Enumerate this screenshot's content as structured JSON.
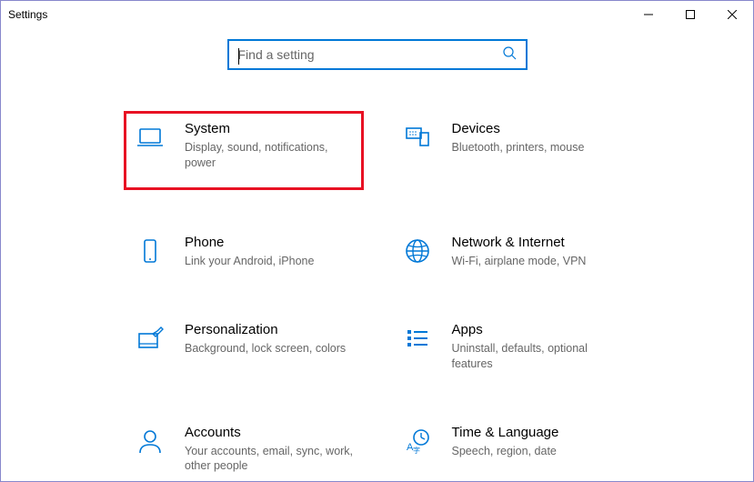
{
  "window": {
    "title": "Settings"
  },
  "search": {
    "placeholder": "Find a setting"
  },
  "categories": [
    {
      "id": "system",
      "title": "System",
      "desc": "Display, sound, notifications, power",
      "highlighted": true
    },
    {
      "id": "devices",
      "title": "Devices",
      "desc": "Bluetooth, printers, mouse",
      "highlighted": false
    },
    {
      "id": "phone",
      "title": "Phone",
      "desc": "Link your Android, iPhone",
      "highlighted": false
    },
    {
      "id": "network",
      "title": "Network & Internet",
      "desc": "Wi-Fi, airplane mode, VPN",
      "highlighted": false
    },
    {
      "id": "personalization",
      "title": "Personalization",
      "desc": "Background, lock screen, colors",
      "highlighted": false
    },
    {
      "id": "apps",
      "title": "Apps",
      "desc": "Uninstall, defaults, optional features",
      "highlighted": false
    },
    {
      "id": "accounts",
      "title": "Accounts",
      "desc": "Your accounts, email, sync, work, other people",
      "highlighted": false
    },
    {
      "id": "time",
      "title": "Time & Language",
      "desc": "Speech, region, date",
      "highlighted": false
    }
  ]
}
